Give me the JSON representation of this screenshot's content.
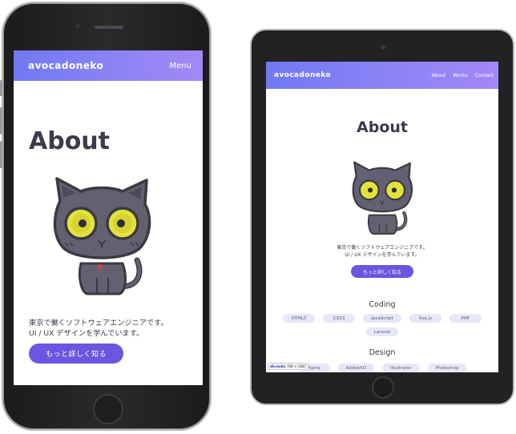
{
  "brand": {
    "logo": "avocadoneko",
    "accent": "#6a56e0",
    "gradient_start": "#7179f3",
    "gradient_end": "#a487f7"
  },
  "phone": {
    "nav": {
      "menu_label": "Menu"
    },
    "page_title": "About",
    "intro_line1": "東京で働くソフトウェアエンジニアです。",
    "intro_line2": "UI / UX デザインを学んでいます。",
    "cta_label": "もっと詳しく知る"
  },
  "tablet": {
    "nav": {
      "links": [
        "About",
        "Works",
        "Contact"
      ]
    },
    "page_title": "About",
    "intro_line1": "東京で働くソフトウェアエンジニアです。",
    "intro_line2": "UI / UX デザインを学んでいます。",
    "cta_label": "もっと詳しく知る",
    "coding": {
      "title": "Coding",
      "tags": [
        "HTML5",
        "CSS3",
        "JavaScript",
        "Vue.js",
        "PHP",
        "Laravel"
      ]
    },
    "design": {
      "title": "Design",
      "tags": [
        "Figma",
        "AdobeXD",
        "Illustrator",
        "Photoshop"
      ]
    },
    "debug_badge": {
      "tag": "div.main",
      "size": "768 × 1887"
    }
  },
  "icons": {
    "cat": "cat-mascot-icon"
  }
}
